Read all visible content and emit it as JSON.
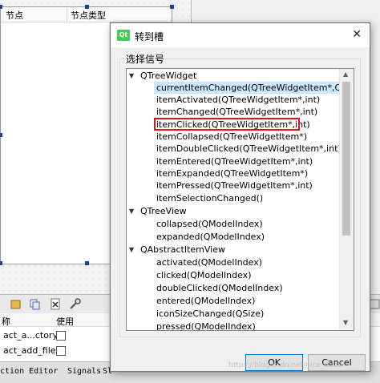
{
  "designer": {
    "tree_columns": [
      "节点",
      "节点类型"
    ]
  },
  "action_editor": {
    "header_name_fragment": "称",
    "header_used": "使用",
    "rows": [
      {
        "name": "act_a...ctory"
      },
      {
        "name": "act_add_file"
      }
    ]
  },
  "bottom_tabs": {
    "tab1": "ction Editor",
    "tab2": "Signals",
    "tab3": "Sl"
  },
  "dialog": {
    "title": "转到槽",
    "app_icon_text": "Qt",
    "group_label": "选择信号",
    "groups": [
      {
        "name": "QTreeWidget",
        "items": [
          "currentItemChanged(QTreeWidgetItem*,QTree",
          "itemActivated(QTreeWidgetItem*,int)",
          "itemChanged(QTreeWidgetItem*,int)",
          "itemClicked(QTreeWidgetItem*,int)",
          "itemCollapsed(QTreeWidgetItem*)",
          "itemDoubleClicked(QTreeWidgetItem*,int)",
          "itemEntered(QTreeWidgetItem*,int)",
          "itemExpanded(QTreeWidgetItem*)",
          "itemPressed(QTreeWidgetItem*,int)",
          "itemSelectionChanged()"
        ]
      },
      {
        "name": "QTreeView",
        "items": [
          "collapsed(QModelIndex)",
          "expanded(QModelIndex)"
        ]
      },
      {
        "name": "QAbstractItemView",
        "items": [
          "activated(QModelIndex)",
          "clicked(QModelIndex)",
          "doubleClicked(QModelIndex)",
          "entered(QModelIndex)",
          "iconSizeChanged(QSize)",
          "pressed(QModelIndex)"
        ]
      }
    ],
    "selected_item": "currentItemChanged(QTreeWidgetItem*,QTree",
    "highlighted_item": "itemClicked(QTreeWidgetItem*,int)",
    "ok_label": "OK",
    "cancel_label": "Cancel"
  },
  "watermark": "https://blog.csdn.net/nice_8818",
  "colors": {
    "selection": "#cce8ff",
    "highlight_border": "#e01515",
    "qt_green": "#41cd52"
  }
}
